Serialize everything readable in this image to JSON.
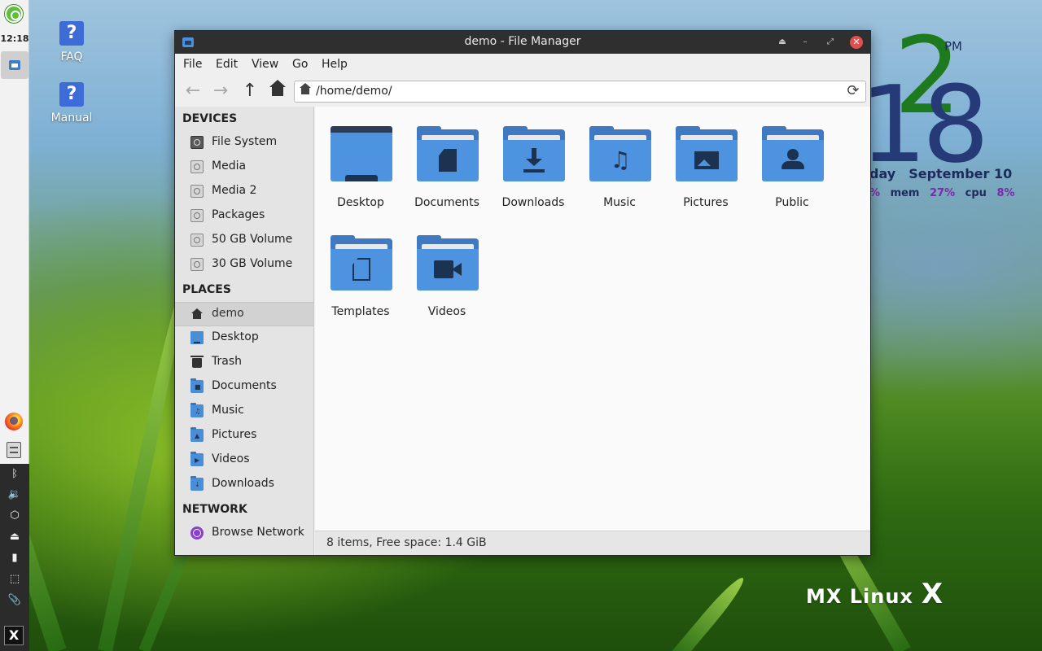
{
  "panel": {
    "clock": "12:18"
  },
  "desktop": {
    "icons": [
      {
        "label": "FAQ",
        "icon": "help-icon"
      },
      {
        "label": "Manual",
        "icon": "help-icon"
      }
    ],
    "conky": {
      "hour": "2",
      "minute": "18",
      "ampm": "PM",
      "day_fragment": "day",
      "date": "September 10",
      "stats": {
        "prefix_pct": "%",
        "mem_label": "mem",
        "mem_pct": "27%",
        "cpu_label": "cpu",
        "cpu_pct": "8%"
      }
    },
    "brand": "MX Linux"
  },
  "window": {
    "title": "demo - File Manager",
    "menu": [
      "File",
      "Edit",
      "View",
      "Go",
      "Help"
    ],
    "path": "/home/demo/",
    "sidebar": {
      "devices_header": "DEVICES",
      "devices": [
        "File System",
        "Media",
        "Media 2",
        "Packages",
        "50 GB Volume",
        "30 GB Volume"
      ],
      "places_header": "PLACES",
      "places": [
        "demo",
        "Desktop",
        "Trash",
        "Documents",
        "Music",
        "Pictures",
        "Videos",
        "Downloads"
      ],
      "network_header": "NETWORK",
      "network": [
        "Browse Network"
      ]
    },
    "files": [
      {
        "label": "Desktop",
        "icon": "desktop-folder-icon"
      },
      {
        "label": "Documents",
        "icon": "documents-folder-icon"
      },
      {
        "label": "Downloads",
        "icon": "downloads-folder-icon"
      },
      {
        "label": "Music",
        "icon": "music-folder-icon"
      },
      {
        "label": "Pictures",
        "icon": "pictures-folder-icon"
      },
      {
        "label": "Public",
        "icon": "public-folder-icon"
      },
      {
        "label": "Templates",
        "icon": "templates-folder-icon"
      },
      {
        "label": "Videos",
        "icon": "videos-folder-icon"
      }
    ],
    "status": "8 items, Free space: 1.4 GiB"
  },
  "colors": {
    "folder": "#4d93e0",
    "titlebar": "#2f2f2f",
    "close": "#e05050",
    "conky_hour": "#1e7a1e",
    "conky_minute": "#263a78"
  }
}
